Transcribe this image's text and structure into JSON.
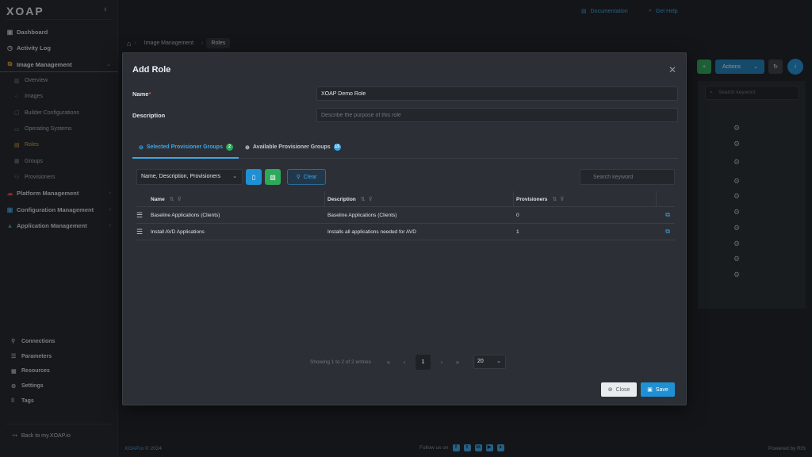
{
  "sidebar": {
    "logo": "XOAP",
    "collapse_icon": "‹",
    "items": [
      {
        "label": "Dashboard",
        "icon": "dashboard-icon"
      },
      {
        "label": "Activity Log",
        "icon": "clock-icon"
      },
      {
        "label": "Image Management",
        "icon": "image-icon"
      }
    ],
    "image_management_children": [
      {
        "label": "Overview"
      },
      {
        "label": "Images"
      },
      {
        "label": "Builder Configurations"
      },
      {
        "label": "Operating Systems"
      },
      {
        "label": "Roles"
      },
      {
        "label": "Groups"
      },
      {
        "label": "Provisioners"
      }
    ],
    "sections": [
      {
        "label": "Platform Management"
      },
      {
        "label": "Configuration Management"
      },
      {
        "label": "Application Management"
      }
    ],
    "bottom": [
      {
        "label": "Connections"
      },
      {
        "label": "Parameters"
      },
      {
        "label": "Resources"
      },
      {
        "label": "Settings"
      },
      {
        "label": "Tags"
      }
    ],
    "back_link": "Back to my.XOAP.io",
    "accent_color": "#e7a43a"
  },
  "topbar": {
    "documentation": "Documentation",
    "get_help": "Get Help"
  },
  "breadcrumb": {
    "items": [
      "Image Management",
      "Roles"
    ]
  },
  "background": {
    "actions_label": "Actions",
    "search_placeholder": "Search keyword"
  },
  "modal": {
    "title": "Add Role",
    "name_label": "Name",
    "name_value": "XOAP Demo Role",
    "description_label": "Description",
    "description_placeholder": "Describe the purpose of this role",
    "tabs": [
      {
        "label": "Selected Provisioner Groups",
        "count": "2"
      },
      {
        "label": "Available Provisioner Groups",
        "count": "15"
      }
    ],
    "toolbar": {
      "columns_select": "Name, Description, Provisioners",
      "clear_label": "Clear",
      "search_placeholder": "Search keyword"
    },
    "table": {
      "headers": [
        "Name",
        "Description",
        "Provisioners"
      ],
      "rows": [
        {
          "name": "Baseline Applications (Clients)",
          "description": "Baseline Applications (Clients)",
          "provisioners": "0"
        },
        {
          "name": "Install AVD Applications",
          "description": "Installs all applications needed for AVD",
          "provisioners": "1"
        }
      ]
    },
    "pager": {
      "info": "Showing 1 to 2 of 2 entries",
      "current_page": "1",
      "page_size": "20"
    },
    "close_label": "Close",
    "save_label": "Save"
  },
  "footer": {
    "brand": "XOAP.io",
    "copyright": "© 2024",
    "follow": "Follow us on",
    "powered": "Powered by RIS"
  },
  "colors": {
    "primary": "#1f90d3",
    "success": "#2ea85a",
    "link": "#3ea6e6",
    "required": "#e5484d"
  }
}
